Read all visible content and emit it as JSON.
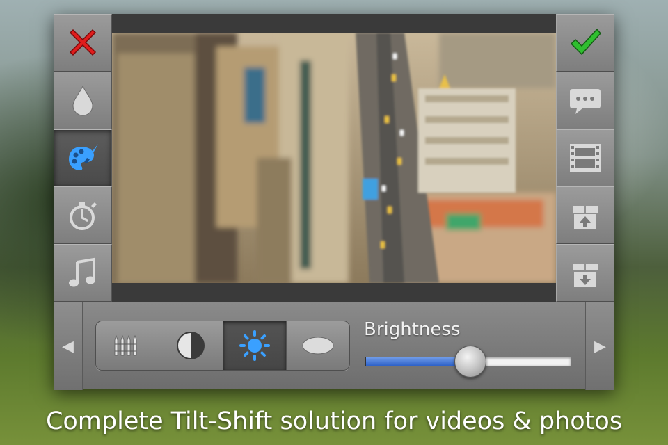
{
  "app": {
    "caption": "Complete Tilt-Shift solution for videos & photos"
  },
  "left_toolbar": {
    "items": [
      {
        "icon": "close-icon",
        "color": "#e01c1c"
      },
      {
        "icon": "drop-icon"
      },
      {
        "icon": "palette-brush-icon",
        "active": true,
        "color": "#3aa0ff"
      },
      {
        "icon": "stopwatch-icon"
      },
      {
        "icon": "music-note-icon"
      }
    ]
  },
  "right_toolbar": {
    "items": [
      {
        "icon": "checkmark-icon",
        "color": "#2fbf2f"
      },
      {
        "icon": "speech-bubble-icon"
      },
      {
        "icon": "film-strip-icon"
      },
      {
        "icon": "box-upload-icon"
      },
      {
        "icon": "box-download-icon"
      }
    ]
  },
  "adjustments": {
    "prev_arrow": "◀",
    "next_arrow": "▶",
    "options": [
      {
        "icon": "crayons-icon"
      },
      {
        "icon": "contrast-icon"
      },
      {
        "icon": "brightness-sun-icon",
        "active": true
      },
      {
        "icon": "ellipse-shape-icon"
      }
    ],
    "slider": {
      "label": "Brightness",
      "value": 0.51,
      "fill_color": "#2e62c8"
    }
  }
}
